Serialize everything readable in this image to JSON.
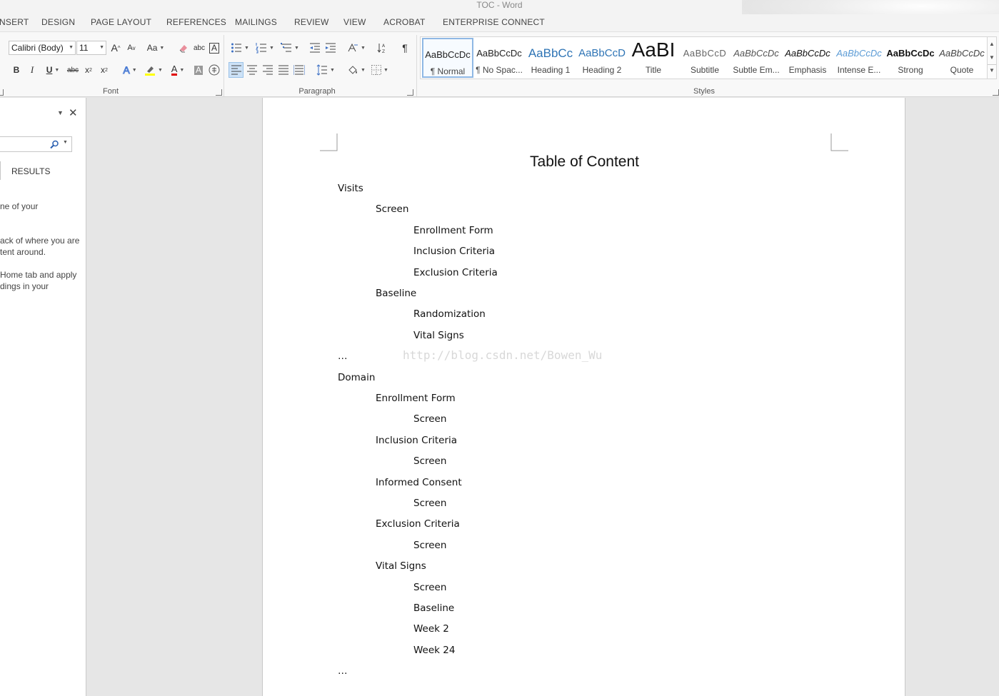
{
  "app": {
    "window_title": "TOC - Word"
  },
  "tabs": [
    {
      "label": "NSERT"
    },
    {
      "label": "DESIGN"
    },
    {
      "label": "PAGE LAYOUT"
    },
    {
      "label": "REFERENCES"
    },
    {
      "label": "MAILINGS"
    },
    {
      "label": "REVIEW"
    },
    {
      "label": "VIEW"
    },
    {
      "label": "ACROBAT"
    },
    {
      "label": "ENTERPRISE CONNECT"
    }
  ],
  "ribbon": {
    "font": {
      "group_label": "Font",
      "font_name": "Calibri (Body)",
      "font_size": "11",
      "grow_label": "A",
      "shrink_label": "A",
      "case_label": "Aa",
      "bold": "B",
      "italic": "I",
      "underline": "U",
      "strike": "abc",
      "subscript": "x",
      "superscript": "x",
      "subscript_mark": "2",
      "superscript_mark": "2",
      "color_label": "A",
      "shade_label": "A",
      "effects_label": "A",
      "clear_label": "A",
      "highlight_color": "#ffff00",
      "font_color": "#e00000"
    },
    "paragraph": {
      "group_label": "Paragraph",
      "pilcrow": "¶",
      "sort_label": "A"
    },
    "styles": {
      "group_label": "Styles",
      "items": [
        {
          "preview": "AaBbCcDc",
          "name": "¶ Normal",
          "selected": true
        },
        {
          "preview": "AaBbCcDc",
          "name": "¶ No Spac...",
          "selected": false
        },
        {
          "preview": "AaBbCc",
          "name": "Heading 1",
          "selected": false
        },
        {
          "preview": "AaBbCcD",
          "name": "Heading 2",
          "selected": false
        },
        {
          "preview": "AaBI",
          "name": "Title",
          "selected": false
        },
        {
          "preview": "AaBbCcD",
          "name": "Subtitle",
          "selected": false
        },
        {
          "preview": "AaBbCcDc",
          "name": "Subtle Em...",
          "selected": false
        },
        {
          "preview": "AaBbCcDc",
          "name": "Emphasis",
          "selected": false
        },
        {
          "preview": "AaBbCcDc",
          "name": "Intense E...",
          "selected": false
        },
        {
          "preview": "AaBbCcDc",
          "name": "Strong",
          "selected": false
        },
        {
          "preview": "AaBbCcDc",
          "name": "Quote",
          "selected": false
        }
      ]
    }
  },
  "nav_pane": {
    "results_tab": "RESULTS",
    "help_lines": [
      "ne of your",
      "ack of where you are",
      "tent around.",
      "Home tab and apply",
      "dings in your"
    ]
  },
  "document": {
    "title": "Table of Content",
    "watermark": "http://blog.csdn.net/Bowen_Wu",
    "lines": [
      {
        "text": "Visits",
        "level": 1
      },
      {
        "text": "Screen",
        "level": 2
      },
      {
        "text": "Enrollment Form",
        "level": 3
      },
      {
        "text": "Inclusion Criteria",
        "level": 3
      },
      {
        "text": "Exclusion Criteria",
        "level": 3
      },
      {
        "text": "Baseline",
        "level": 2
      },
      {
        "text": "Randomization",
        "level": 3
      },
      {
        "text": "Vital Signs",
        "level": 3
      },
      {
        "text": "…",
        "level": 1
      },
      {
        "text": "Domain",
        "level": 1
      },
      {
        "text": "Enrollment Form",
        "level": 2
      },
      {
        "text": "Screen",
        "level": 3
      },
      {
        "text": "Inclusion Criteria",
        "level": 2
      },
      {
        "text": "Screen",
        "level": 3
      },
      {
        "text": "Informed Consent",
        "level": 2
      },
      {
        "text": "Screen",
        "level": 3
      },
      {
        "text": "Exclusion Criteria",
        "level": 2
      },
      {
        "text": "Screen",
        "level": 3
      },
      {
        "text": "Vital Signs",
        "level": 2
      },
      {
        "text": "Screen",
        "level": 3
      },
      {
        "text": "Baseline",
        "level": 3
      },
      {
        "text": "Week 2",
        "level": 3
      },
      {
        "text": "Week 24",
        "level": 3
      },
      {
        "text": "…",
        "level": 1
      }
    ]
  }
}
